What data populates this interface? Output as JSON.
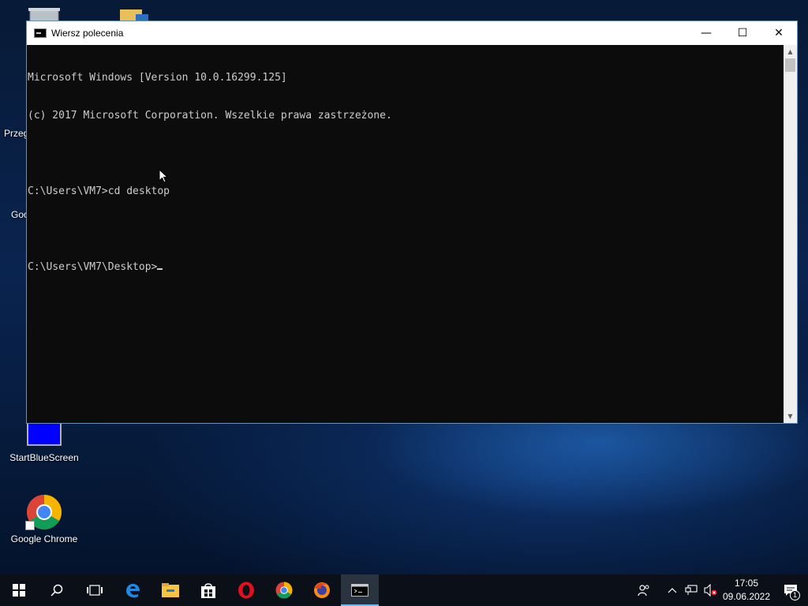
{
  "desktop": {
    "icons": [
      {
        "label": "Przeg"
      },
      {
        "label": "Goo"
      },
      {
        "label": "StartBlueScreen"
      },
      {
        "label": "Google Chrome"
      }
    ]
  },
  "window": {
    "title": "Wiersz polecenia",
    "controls": {
      "minimize": "—",
      "maximize": "☐",
      "close": "✕"
    },
    "console_lines": [
      "Microsoft Windows [Version 10.0.16299.125]",
      "(c) 2017 Microsoft Corporation. Wszelkie prawa zastrzeżone.",
      "",
      "C:\\Users\\VM7>cd desktop",
      "",
      "C:\\Users\\VM7\\Desktop>"
    ]
  },
  "taskbar": {
    "items": [
      "start-icon",
      "search-icon",
      "task-view-icon",
      "edge-icon",
      "file-explorer-icon",
      "store-icon",
      "opera-icon",
      "chrome-icon",
      "firefox-icon",
      "command-prompt-icon"
    ],
    "tray": {
      "time": "17:05",
      "date": "09.06.2022",
      "notification_count": "1"
    }
  }
}
